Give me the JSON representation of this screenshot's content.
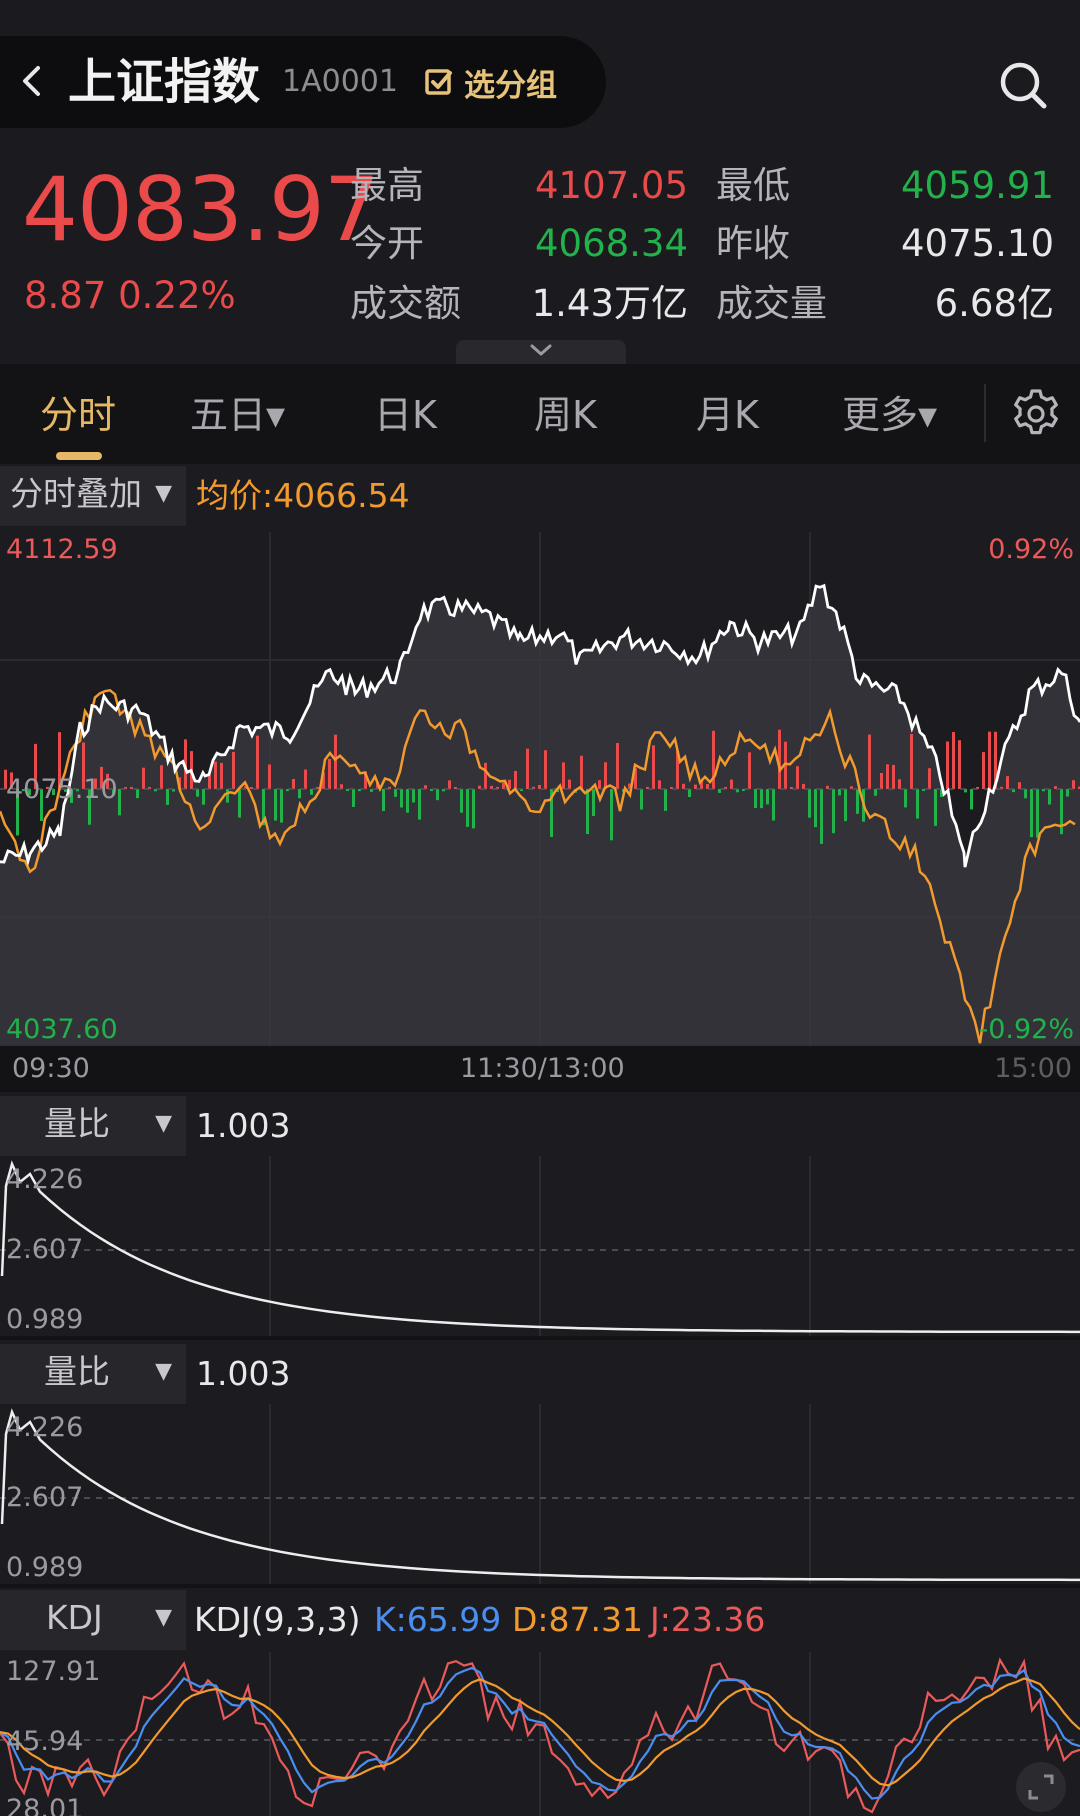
{
  "header": {
    "title": "上证指数",
    "code": "1A0001",
    "group_label": "选分组"
  },
  "quote": {
    "price": "4083.97",
    "change": "8.87 0.22%",
    "rows": [
      {
        "l1": "最高",
        "v1": "4107.05",
        "c1": "red",
        "l2": "最低",
        "v2": "4059.91",
        "c2": "green"
      },
      {
        "l1": "今开",
        "v1": "4068.34",
        "c1": "green",
        "l2": "昨收",
        "v2": "4075.10",
        "c2": "white"
      },
      {
        "l1": "成交额",
        "v1": "1.43万亿",
        "c1": "white",
        "l2": "成交量",
        "v2": "6.68亿",
        "c2": "white"
      }
    ]
  },
  "tabs": [
    "分时",
    "五日▾",
    "日K",
    "周K",
    "月K",
    "更多▾"
  ],
  "intraday": {
    "selector": "分时叠加",
    "avg_label": "均价:4066.54",
    "y_top": "4112.59",
    "y_mid": "4075.10",
    "y_bot": "4037.60",
    "pct_top": "0.92%",
    "pct_bot": "-0.92%",
    "time_start": "09:30",
    "time_mid": "11:30/13:00",
    "time_end": "15:00"
  },
  "volratio1": {
    "selector": "量比",
    "value": "1.003",
    "y_top": "4.226",
    "y_mid": "2.607",
    "y_bot": "0.989"
  },
  "volratio2": {
    "selector": "量比",
    "value": "1.003",
    "y_top": "4.226",
    "y_mid": "2.607",
    "y_bot": "0.989"
  },
  "kdj": {
    "selector": "KDJ",
    "params": "KDJ(9,3,3)",
    "k": "K:65.99",
    "d": "D:87.31",
    "j": "J:23.36",
    "y_top": "127.91",
    "y_mid": "45.94",
    "y_bot": "28.01"
  },
  "colors": {
    "up": "#ea4a4a",
    "down": "#22b24c",
    "price_line": "#ffffff",
    "avg_line": "#f29a2e",
    "k_line": "#4a8ef0",
    "d_line": "#f29a2e",
    "j_line": "#ea5a5a",
    "accent": "#e6b866"
  }
}
